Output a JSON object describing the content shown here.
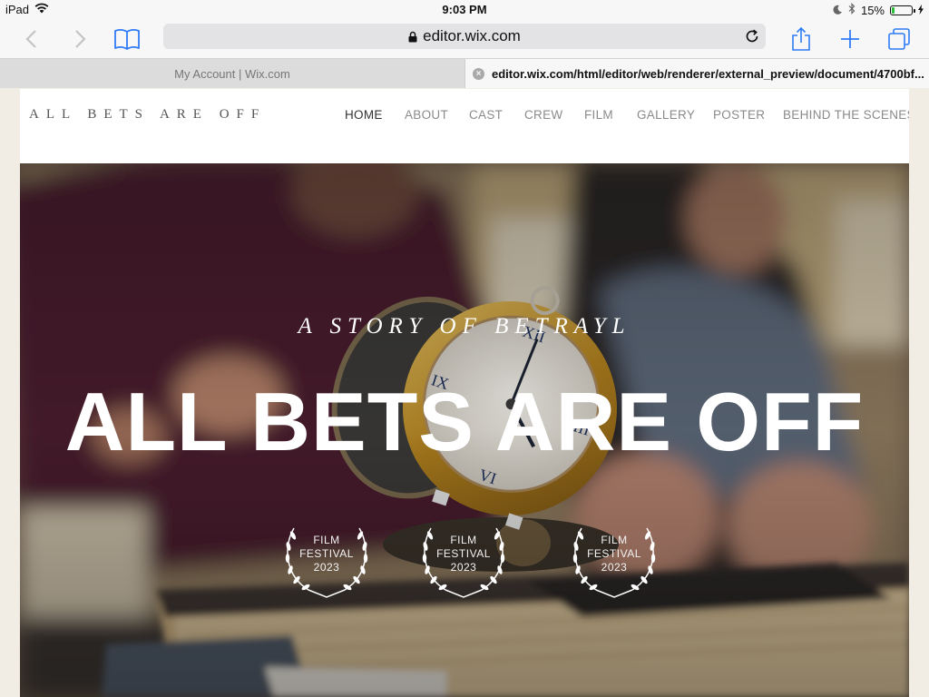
{
  "status_bar": {
    "device": "iPad",
    "time": "9:03 PM",
    "battery_percent": "15%",
    "battery_level": 0.15
  },
  "browser": {
    "url": "editor.wix.com",
    "tabs": [
      {
        "label": "My Account | Wix.com"
      },
      {
        "label": "editor.wix.com/html/editor/web/renderer/external_preview/document/4700bf..."
      }
    ]
  },
  "site": {
    "logo": "ALL BETS ARE OFF",
    "nav": [
      {
        "label": "HOME"
      },
      {
        "label": "ABOUT"
      },
      {
        "label": "CAST"
      },
      {
        "label": "CREW"
      },
      {
        "label": "FILM"
      },
      {
        "label": "GALLERY"
      },
      {
        "label": "POSTER"
      },
      {
        "label": "BEHIND THE SCENES"
      }
    ],
    "hero": {
      "tagline": "A STORY OF BETRAYL",
      "title": "ALL BETS ARE OFF",
      "laurels": [
        {
          "line1": "FILM",
          "line2": "FESTIVAL",
          "line3": "2023"
        },
        {
          "line1": "FILM",
          "line2": "FESTIVAL",
          "line3": "2023"
        },
        {
          "line1": "FILM",
          "line2": "FESTIVAL",
          "line3": "2023"
        }
      ]
    }
  },
  "colors": {
    "ios_blue": "#2f7cf6",
    "battery_green": "#2dbb3c",
    "nav_active": "#333333",
    "nav_inactive": "#8a8a8a"
  }
}
